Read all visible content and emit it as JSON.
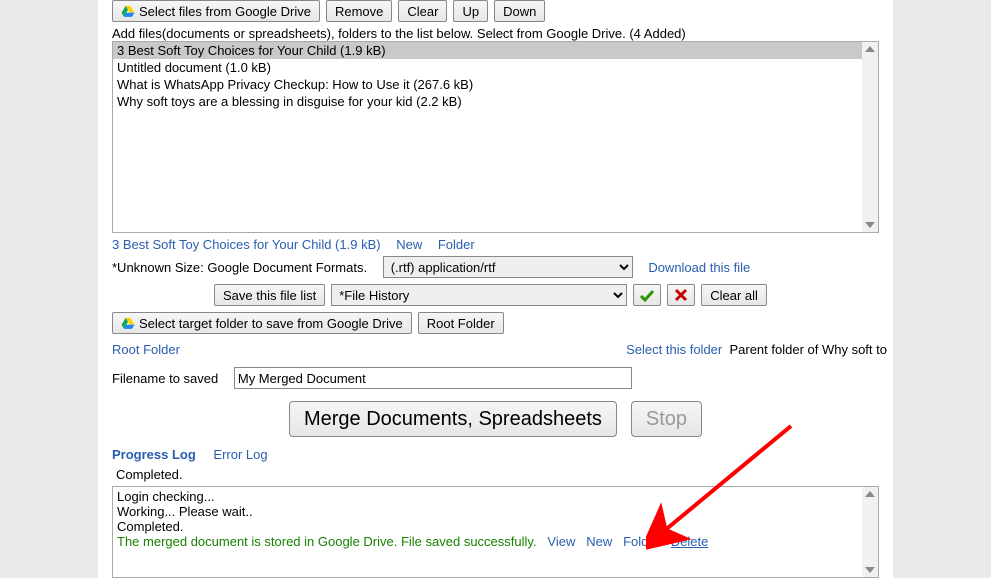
{
  "toolbar": {
    "select_files": "Select files from Google Drive",
    "remove": "Remove",
    "clear": "Clear",
    "up": "Up",
    "down": "Down"
  },
  "add_hint": "Add files(documents or spreadsheets), folders to the list below. Select from Google Drive. (4 Added)",
  "files": [
    "3 Best Soft Toy Choices for Your Child (1.9 kB)",
    "Untitled document (1.0 kB)",
    "What is WhatsApp Privacy Checkup: How to Use it (267.6 kB)",
    "Why soft toys are a blessing in disguise for your kid (2.2 kB)"
  ],
  "selected_file": "3 Best Soft Toy Choices for Your Child (1.9 kB)",
  "after_list": {
    "new": "New",
    "folder": "Folder"
  },
  "unknown_size_label": "*Unknown Size: Google Document Formats.",
  "format_select": "(.rtf) application/rtf",
  "download_link": "Download this file",
  "save_list": "Save this file list",
  "history_select": "*File History",
  "clear_all": "Clear all",
  "target_folder": "Select target folder to save from Google Drive",
  "root_folder_btn": "Root Folder",
  "root_folder_link": "Root Folder",
  "select_this_folder": "Select this folder",
  "parent_of": "Parent folder of Why soft to",
  "filename_label": "Filename to saved",
  "filename_value": "My Merged Document",
  "merge_btn": "Merge Documents, Spreadsheets",
  "stop_btn": "Stop",
  "tab_progress": "Progress Log",
  "tab_error": "Error Log",
  "status_done": "Completed.",
  "log_lines": {
    "l1": "Login checking...",
    "l2": "Working... Please wait..",
    "l3": "Completed.",
    "l4": "The merged document is stored in Google Drive. File saved successfully.",
    "view": "View",
    "new": "New",
    "folder": "Folder",
    "delete": "Delete"
  }
}
